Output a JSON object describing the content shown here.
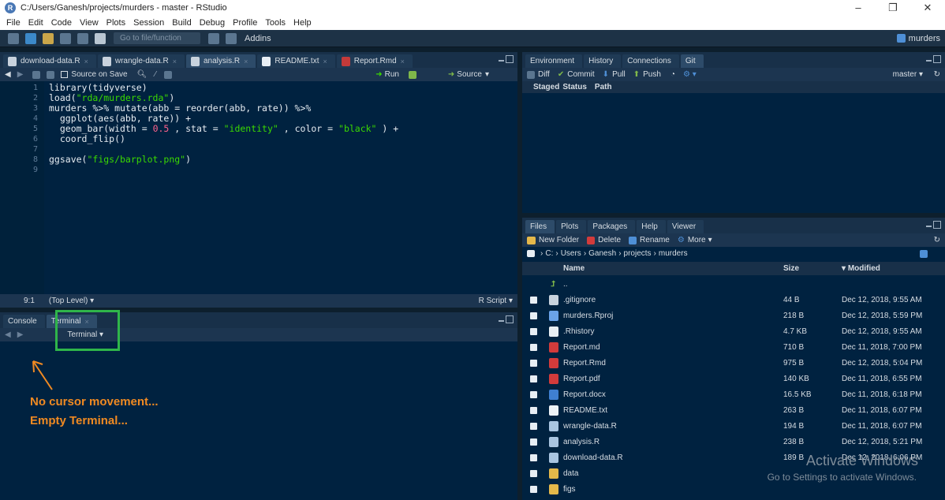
{
  "window": {
    "title": "C:/Users/Ganesh/projects/murders - master - RStudio"
  },
  "menu": [
    "File",
    "Edit",
    "Code",
    "View",
    "Plots",
    "Session",
    "Build",
    "Debug",
    "Profile",
    "Tools",
    "Help"
  ],
  "toolbar": {
    "goto_placeholder": "Go to file/function",
    "addins": "Addins",
    "project": "murders"
  },
  "editor": {
    "tabs": [
      {
        "label": "download-data.R",
        "icon": "r-file-icon"
      },
      {
        "label": "wrangle-data.R",
        "icon": "r-file-icon"
      },
      {
        "label": "analysis.R",
        "icon": "r-file-icon",
        "active": true
      },
      {
        "label": "README.txt",
        "icon": "txt-file-icon"
      },
      {
        "label": "Report.Rmd",
        "icon": "rmd-file-icon"
      }
    ],
    "source_on_save": "Source on Save",
    "run": "Run",
    "source": "Source",
    "lines": [
      "1",
      "2",
      "3",
      "4",
      "5",
      "6",
      "7",
      "8",
      "9"
    ],
    "code": {
      "l1a": "library(tidyverse)",
      "l2a": "load(",
      "l2s": "\"rda/murders.rda\"",
      "l2b": ")",
      "l3": "murders %>% mutate(abb = reorder(abb, rate)) %>%",
      "l4": "  ggplot(aes(abb, rate)) +",
      "l5a": "  geom_bar(width = ",
      "l5n": "0.5",
      "l5b": " , stat = ",
      "l5s1": "\"identity\"",
      "l5c": " , color = ",
      "l5s2": "\"black\"",
      "l5d": " ) +",
      "l6": "  coord_flip()",
      "l8a": "ggsave(",
      "l8s": "\"figs/barplot.png\"",
      "l8b": ")"
    },
    "status_pos": "9:1",
    "status_scope": "(Top Level)",
    "status_lang": "R Script"
  },
  "console": {
    "tabs": [
      "Console",
      "Terminal"
    ],
    "terminal_dropdown": "Terminal"
  },
  "annotation": {
    "line1": "No cursor movement...",
    "line2": "Empty Terminal..."
  },
  "env_pane": {
    "tabs": [
      "Environment",
      "History",
      "Connections",
      "Git"
    ],
    "git_tools": {
      "diff": "Diff",
      "commit": "Commit",
      "pull": "Pull",
      "push": "Push",
      "branch": "master"
    },
    "columns": {
      "staged": "Staged",
      "status": "Status",
      "path": "Path"
    }
  },
  "files_pane": {
    "tabs": [
      "Files",
      "Plots",
      "Packages",
      "Help",
      "Viewer"
    ],
    "tools": {
      "new_folder": "New Folder",
      "delete": "Delete",
      "rename": "Rename",
      "more": "More"
    },
    "breadcrumb": [
      "C:",
      "Users",
      "Ganesh",
      "projects",
      "murders"
    ],
    "columns": {
      "name": "Name",
      "size": "Size",
      "modified": "Modified"
    },
    "up": "..",
    "rows": [
      {
        "name": ".gitignore",
        "size": "44 B",
        "modified": "Dec 12, 2018, 9:55 AM",
        "icon": "ic-git"
      },
      {
        "name": "murders.Rproj",
        "size": "218 B",
        "modified": "Dec 12, 2018, 5:59 PM",
        "icon": "ic-proj"
      },
      {
        "name": ".Rhistory",
        "size": "4.7 KB",
        "modified": "Dec 12, 2018, 9:55 AM",
        "icon": "ic-hist"
      },
      {
        "name": "Report.md",
        "size": "710 B",
        "modified": "Dec 11, 2018, 7:00 PM",
        "icon": "ic-md"
      },
      {
        "name": "Report.Rmd",
        "size": "975 B",
        "modified": "Dec 12, 2018, 5:04 PM",
        "icon": "ic-md"
      },
      {
        "name": "Report.pdf",
        "size": "140 KB",
        "modified": "Dec 11, 2018, 6:55 PM",
        "icon": "ic-pdf"
      },
      {
        "name": "Report.docx",
        "size": "16.5 KB",
        "modified": "Dec 11, 2018, 6:18 PM",
        "icon": "ic-docx"
      },
      {
        "name": "README.txt",
        "size": "263 B",
        "modified": "Dec 11, 2018, 6:07 PM",
        "icon": "ic-txt"
      },
      {
        "name": "wrangle-data.R",
        "size": "194 B",
        "modified": "Dec 11, 2018, 6:07 PM",
        "icon": "ic-r"
      },
      {
        "name": "analysis.R",
        "size": "238 B",
        "modified": "Dec 12, 2018, 5:21 PM",
        "icon": "ic-r"
      },
      {
        "name": "download-data.R",
        "size": "189 B",
        "modified": "Dec 12, 2018, 6:06 PM",
        "icon": "ic-r"
      },
      {
        "name": "data",
        "size": "",
        "modified": "",
        "icon": "ic-folder"
      },
      {
        "name": "figs",
        "size": "",
        "modified": "",
        "icon": "ic-folder"
      }
    ]
  },
  "watermark": {
    "line1": "Activate Windows",
    "line2": "Go to Settings to activate Windows."
  }
}
